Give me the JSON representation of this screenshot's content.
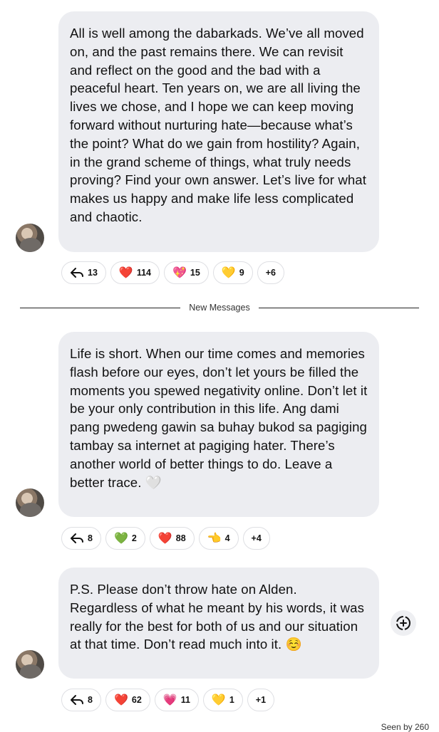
{
  "messages": [
    {
      "text": "All is well among the dabarkads. We’ve all moved on, and the past remains there. We can revisit and reflect on the good and the bad with a peaceful heart. Ten years on, we are all living the lives we chose, and I hope we can keep moving forward without nurturing hate—because what’s the point? What do we gain from hostility? Again, in the grand scheme of things, what truly needs proving? Find your own answer. Let’s live for what makes us happy and make life less complicated and chaotic.",
      "replies": "13",
      "reactions": [
        {
          "emoji": "❤️",
          "count": "114"
        },
        {
          "emoji": "💖",
          "count": "15"
        },
        {
          "emoji": "💛",
          "count": "9"
        }
      ],
      "more": "+6"
    },
    {
      "text": "Life is short. When our time comes and memories flash before our eyes, don’t let yours be filled the moments you spewed negativity online. Don’t let it be your only contribution in this life. Ang dami pang pwedeng gawin sa buhay bukod sa pagiging tambay sa internet at pagiging hater. There’s another world of better things to do. Leave a better trace. 🤍",
      "replies": "8",
      "reactions": [
        {
          "emoji": "💚",
          "count": "2"
        },
        {
          "emoji": "❤️",
          "count": "88"
        },
        {
          "emoji": "👈",
          "count": "4"
        }
      ],
      "more": "+4"
    },
    {
      "text": "P.S. Please don’t throw hate on Alden. Regardless of what he meant by his words, it was really for the best for both of us and our situation at that time. Don’t read much into it. ☺️",
      "replies": "8",
      "reactions": [
        {
          "emoji": "❤️",
          "count": "62"
        },
        {
          "emoji": "💗",
          "count": "11"
        },
        {
          "emoji": "💛",
          "count": "1"
        }
      ],
      "more": "+1"
    }
  ],
  "divider_label": "New Messages",
  "seen_text": "Seen by 260",
  "icons": {
    "reply": "reply-arrow-icon",
    "add_reaction": "add-reaction-icon"
  }
}
